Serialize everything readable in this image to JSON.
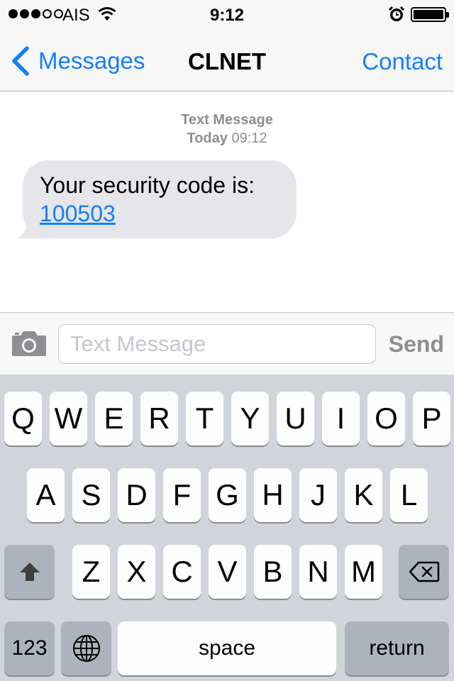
{
  "status_bar": {
    "carrier": "AIS",
    "time": "9:12",
    "signal_bars_filled": 3,
    "signal_bars_total": 5
  },
  "nav": {
    "back_label": "Messages",
    "title": "CLNET",
    "contact_label": "Contact"
  },
  "conversation": {
    "header_type": "Text Message",
    "header_day": "Today",
    "header_time": "09:12",
    "message_text": "Your security code is:",
    "message_code": "100503"
  },
  "input": {
    "placeholder": "Text Message",
    "value": "",
    "send_label": "Send"
  },
  "keyboard": {
    "row1": [
      "Q",
      "W",
      "E",
      "R",
      "T",
      "Y",
      "U",
      "I",
      "O",
      "P"
    ],
    "row2": [
      "A",
      "S",
      "D",
      "F",
      "G",
      "H",
      "J",
      "K",
      "L"
    ],
    "row3": [
      "Z",
      "X",
      "C",
      "V",
      "B",
      "N",
      "M"
    ],
    "numbers_label": "123",
    "space_label": "space",
    "return_label": "return"
  },
  "colors": {
    "accent": "#157efb",
    "bubble": "#e5e5ea",
    "keyboard_bg": "#d1d5db"
  },
  "icons": [
    "back-chevron-icon",
    "wifi-icon",
    "alarm-icon",
    "battery-icon",
    "camera-icon",
    "shift-icon",
    "delete-icon",
    "globe-icon"
  ]
}
